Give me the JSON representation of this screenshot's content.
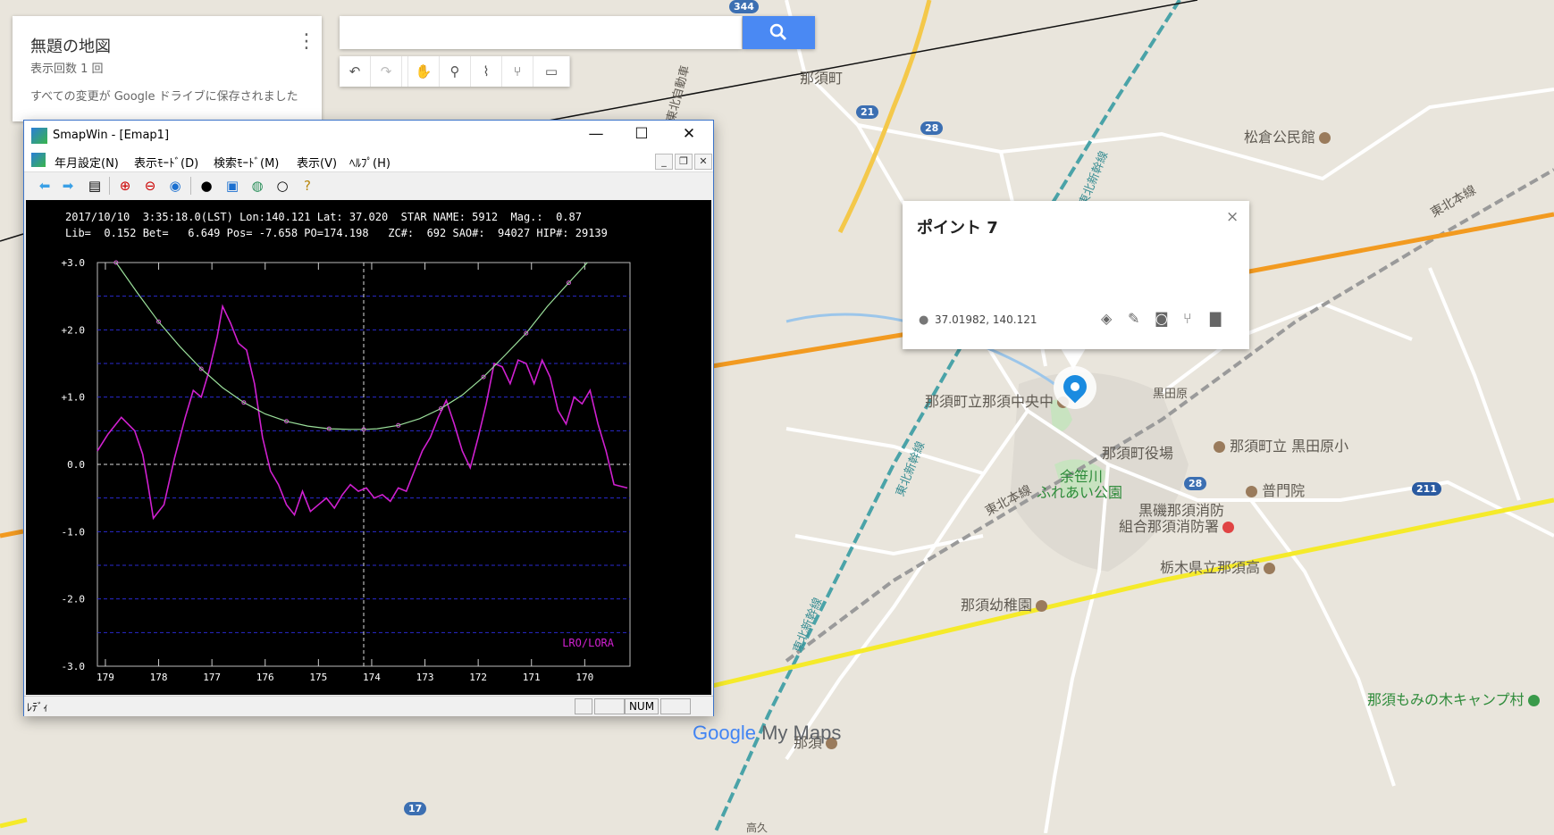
{
  "map": {
    "labels": {
      "nasu_town": "那須町",
      "matsukura": "松倉公民館",
      "nasu_chuo": "那須町立那須中央中",
      "kurodahara": "那須町立 黒田原小",
      "town_office": "那須町役場",
      "yosasa_1": "余笹川",
      "yosasa_2": "ふれあい公園",
      "fumon": "普門院",
      "fire_1": "黒磯那須消防",
      "fire_2": "組合那須消防署",
      "nasu_high": "栃木県立那須高",
      "kindergarten": "那須幼稚園",
      "momi": "那須もみの木キャンプ村",
      "nasu_bottom": "那須",
      "tohoku_line_1": "東北本線",
      "tohoku_line_2": "東北本線",
      "shinkansen_1": "東北新幹線",
      "shinkansen_2": "東北新幹線",
      "shinkansen_3": "東北新幹線",
      "expressway": "東北自動車",
      "takaku": "高久",
      "kurodahara_stn": "黒田原"
    },
    "shields": {
      "r344": "344",
      "r21": "21",
      "r28a": "28",
      "r28b": "28",
      "r211": "211",
      "r17": "17"
    },
    "logo_google": "Google",
    "logo_mymaps": "My Maps"
  },
  "mymaps": {
    "title": "無題の地図",
    "views": "表示回数 1 回",
    "saved": "すべての変更が Google ドライブに保存されました",
    "more_icon": "⋮",
    "search_placeholder": "",
    "search_icon": "search-icon",
    "toolbar": [
      "undo-icon",
      "redo-icon",
      "hand-icon",
      "marker-icon",
      "draw-line-icon",
      "directions-icon",
      "ruler-icon"
    ]
  },
  "infowindow": {
    "title": "ポイント 7",
    "coords": "37.01982, 140.121",
    "close": "×"
  },
  "smapwin": {
    "title": "SmapWin - [Emap1]",
    "menu": {
      "m1": "年月設定(N)",
      "m2": "表示ﾓｰﾄﾞ(D)",
      "m3": "検索ﾓｰﾄﾞ(M)",
      "m4": "表示(V)",
      "m5": "ﾍﾙﾌﾟ(H)"
    },
    "header_line1": "2017/10/10  3:35:18.0(LST) Lon:140.121 Lat: 37.020  STAR NAME: 5912  Mag.:  0.87",
    "header_line2": "Lib=  0.152 Bet=   6.649 Pos= -7.658 PO=174.198   ZC#:  692 SAO#:  94027 HIP#: 29139",
    "status": "ﾚﾃﾞｨ",
    "status_num": "NUM",
    "colors": {
      "plot_bg": "#000000",
      "grid": "#2a2ad0",
      "profile": "#d020d0",
      "limb": "#9be09b",
      "accent": "#3b73c9"
    }
  },
  "chart_data": {
    "type": "line",
    "legend": "LRO/LORA",
    "xlim": [
      179.15,
      169.15
    ],
    "ylim": [
      -3.0,
      3.0
    ],
    "xticks": [
      "179",
      "178",
      "177",
      "176",
      "175",
      "174",
      "173",
      "172",
      "171",
      "170"
    ],
    "yticks": [
      "+3.0",
      "+2.0",
      "+1.0",
      "0.0",
      "-1.0",
      "-2.0",
      "-3.0"
    ],
    "marker_x": 174.15,
    "series": [
      {
        "name": "LRO/LORA",
        "x": [
          179.15,
          178.95,
          178.7,
          178.45,
          178.3,
          178.2,
          178.1,
          177.9,
          177.7,
          177.5,
          177.35,
          177.2,
          177.05,
          176.9,
          176.8,
          176.65,
          176.5,
          176.35,
          176.2,
          176.05,
          175.9,
          175.75,
          175.6,
          175.45,
          175.3,
          175.15,
          175.0,
          174.85,
          174.7,
          174.55,
          174.4,
          174.25,
          174.1,
          173.95,
          173.8,
          173.65,
          173.5,
          173.35,
          173.2,
          173.05,
          172.9,
          172.75,
          172.6,
          172.45,
          172.3,
          172.15,
          172.0,
          171.85,
          171.7,
          171.55,
          171.4,
          171.25,
          171.1,
          170.95,
          170.8,
          170.65,
          170.5,
          170.35,
          170.2,
          170.05,
          169.9,
          169.75,
          169.6,
          169.45,
          169.2
        ],
        "y": [
          0.2,
          0.45,
          0.7,
          0.5,
          0.15,
          -0.3,
          -0.8,
          -0.6,
          0.1,
          0.7,
          1.1,
          1.0,
          1.4,
          1.9,
          2.35,
          2.1,
          1.8,
          1.7,
          1.2,
          0.4,
          -0.1,
          -0.3,
          -0.6,
          -0.75,
          -0.4,
          -0.7,
          -0.6,
          -0.5,
          -0.65,
          -0.45,
          -0.3,
          -0.4,
          -0.35,
          -0.5,
          -0.45,
          -0.55,
          -0.35,
          -0.4,
          -0.1,
          0.2,
          0.4,
          0.7,
          0.95,
          0.6,
          0.2,
          -0.05,
          0.4,
          0.9,
          1.5,
          1.45,
          1.2,
          1.55,
          1.5,
          1.2,
          1.55,
          1.3,
          0.8,
          0.6,
          1.0,
          0.9,
          1.1,
          0.6,
          0.2,
          -0.3,
          -0.35
        ]
      },
      {
        "name": "",
        "x": [
          178.8,
          178.4,
          178.0,
          177.6,
          177.2,
          176.8,
          176.4,
          176.0,
          175.6,
          175.2,
          174.8,
          174.4,
          174.15,
          173.9,
          173.5,
          173.1,
          172.7,
          172.3,
          171.9,
          171.5,
          171.1,
          170.7,
          170.3,
          169.95
        ],
        "y": [
          3.0,
          2.55,
          2.12,
          1.75,
          1.42,
          1.14,
          0.92,
          0.75,
          0.64,
          0.57,
          0.53,
          0.52,
          0.52,
          0.53,
          0.58,
          0.68,
          0.83,
          1.03,
          1.3,
          1.62,
          1.95,
          2.35,
          2.7,
          3.0
        ]
      }
    ]
  }
}
